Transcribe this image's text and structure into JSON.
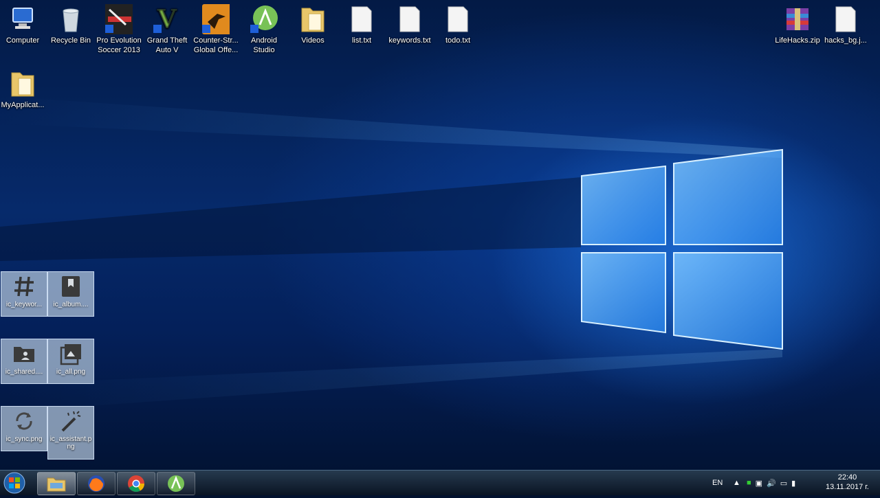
{
  "desktop_icons": [
    {
      "name": "computer",
      "label": "Computer"
    },
    {
      "name": "recycle-bin",
      "label": "Recycle Bin"
    },
    {
      "name": "pes",
      "label": "Pro Evolution\nSoccer 2013"
    },
    {
      "name": "gta",
      "label": "Grand Theft\nAuto V"
    },
    {
      "name": "csgo",
      "label": "Counter-Str...\nGlobal Offe..."
    },
    {
      "name": "android-studio",
      "label": "Android\nStudio"
    },
    {
      "name": "videos",
      "label": "Videos"
    },
    {
      "name": "list",
      "label": "list.txt"
    },
    {
      "name": "keywords",
      "label": "keywords.txt"
    },
    {
      "name": "todo",
      "label": "todo.txt"
    },
    {
      "name": "lifehacks",
      "label": "LifeHacks.zip"
    },
    {
      "name": "hacks-bg",
      "label": "hacks_bg.j..."
    },
    {
      "name": "myapplication",
      "label": "MyApplicat..."
    }
  ],
  "tiles": [
    {
      "label": "ic_keywor...",
      "icon": "hash-icon"
    },
    {
      "label": "ic_album....",
      "icon": "bookmark-icon"
    },
    {
      "label": "ic_shared....",
      "icon": "folder-shared-icon"
    },
    {
      "label": "ic_all.png",
      "icon": "image-icon"
    },
    {
      "label": "ic_sync.png",
      "icon": "sync-icon"
    },
    {
      "label": "ic_assistant.p\nng",
      "icon": "magic-wand-icon"
    }
  ],
  "taskbar": {
    "apps": [
      "explorer-icon",
      "firefox-icon",
      "chrome-icon",
      "android-studio-icon"
    ],
    "language": "EN",
    "time": "22:40",
    "date": "13.11.2017 г."
  },
  "colors": {
    "accent": "#1e7bff",
    "taskbar": "#15222f"
  }
}
